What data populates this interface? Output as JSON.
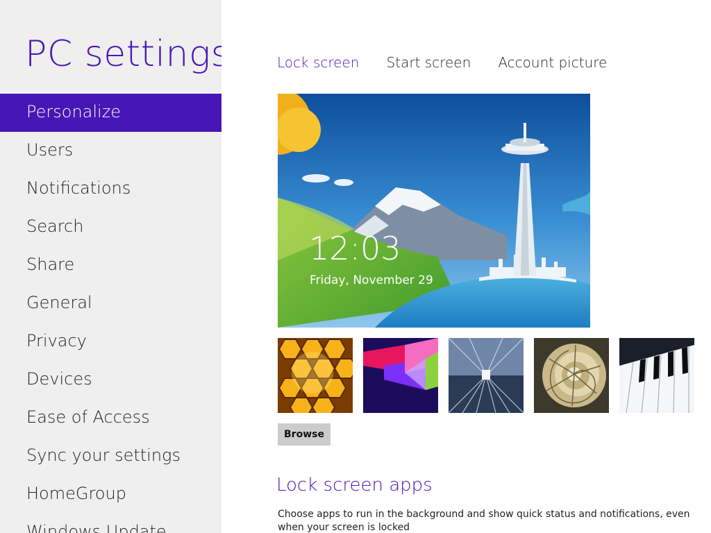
{
  "app": {
    "title": "PC settings"
  },
  "sidebar": {
    "items": [
      {
        "label": "Personalize",
        "selected": true
      },
      {
        "label": "Users",
        "selected": false
      },
      {
        "label": "Notifications",
        "selected": false
      },
      {
        "label": "Search",
        "selected": false
      },
      {
        "label": "Share",
        "selected": false
      },
      {
        "label": "General",
        "selected": false
      },
      {
        "label": "Privacy",
        "selected": false
      },
      {
        "label": "Devices",
        "selected": false
      },
      {
        "label": "Ease of Access",
        "selected": false
      },
      {
        "label": "Sync your settings",
        "selected": false
      },
      {
        "label": "HomeGroup",
        "selected": false
      },
      {
        "label": "Windows Update",
        "selected": false
      }
    ]
  },
  "tabs": [
    {
      "label": "Lock screen",
      "active": true
    },
    {
      "label": "Start screen",
      "active": false
    },
    {
      "label": "Account picture",
      "active": false
    }
  ],
  "lock_preview": {
    "time": "12:03",
    "date": "Friday, November 29"
  },
  "thumbnails": [
    {
      "subject": "honeycomb"
    },
    {
      "subject": "geometric-shapes"
    },
    {
      "subject": "tunnel"
    },
    {
      "subject": "nautilus-shell"
    },
    {
      "subject": "piano-keys"
    }
  ],
  "browse_label": "Browse",
  "lock_screen_apps": {
    "heading": "Lock screen apps",
    "description": "Choose apps to run in the background and show quick status and notifications, even when your screen is locked"
  },
  "colors": {
    "accent": "#4617b4",
    "sidebar_bg": "#efefef",
    "button_bg": "#cccccc"
  }
}
